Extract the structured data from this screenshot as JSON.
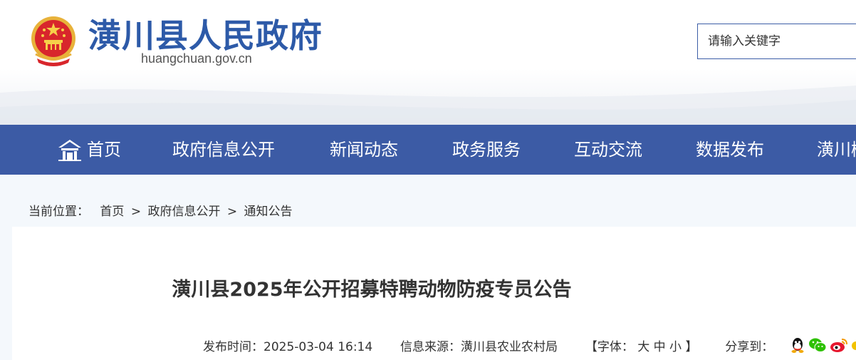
{
  "header": {
    "title": "潢川县人民政府",
    "domain": "huangchuan.gov.cn",
    "search_placeholder": "请输入关键字"
  },
  "nav": {
    "items": [
      {
        "label": "首页"
      },
      {
        "label": "政府信息公开"
      },
      {
        "label": "新闻动态"
      },
      {
        "label": "政务服务"
      },
      {
        "label": "互动交流"
      },
      {
        "label": "数据发布"
      },
      {
        "label": "潢川概"
      }
    ]
  },
  "breadcrumb": {
    "prefix": "当前位置：",
    "items": [
      "首页",
      "政府信息公开",
      "通知公告"
    ],
    "separator": ">"
  },
  "article": {
    "title": "潢川县2025年公开招募特聘动物防疫专员公告",
    "publish_label": "发布时间：",
    "publish_time": "2025-03-04 16:14",
    "source_label": "信息来源：",
    "source": "潢川县农业农村局",
    "font_open": "【字体：",
    "font_large": "大",
    "font_medium": "中",
    "font_small": "小",
    "font_close": "】",
    "share_label": "分享到："
  },
  "colors": {
    "nav_bg": "#3c5ba5",
    "title_blue": "#2d5aa8",
    "page_bg": "#f4f8fc"
  },
  "icons": [
    "national-emblem-icon",
    "home-icon",
    "qq-icon",
    "wechat-icon",
    "weibo-icon"
  ]
}
